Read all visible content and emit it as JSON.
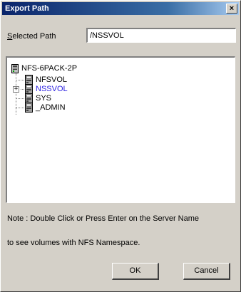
{
  "dialog": {
    "title": "Export Path",
    "close_glyph": "×"
  },
  "path": {
    "label": "Selected Path",
    "label_accel": "S",
    "label_rest": "elected Path",
    "value": "/NSSVOL"
  },
  "tree": {
    "root": {
      "label": "NFS-6PACK-2P",
      "icon": "server-icon"
    },
    "children": [
      {
        "label": "NFSVOL",
        "icon": "volume-icon",
        "expandable": false,
        "selected": false
      },
      {
        "label": "NSSVOL",
        "icon": "volume-icon",
        "expandable": true,
        "selected": true
      },
      {
        "label": "SYS",
        "icon": "volume-icon",
        "expandable": false,
        "selected": false
      },
      {
        "label": "_ADMIN",
        "icon": "volume-icon",
        "expandable": false,
        "selected": false
      }
    ]
  },
  "note": {
    "line1": "Note : Double Click or Press Enter on the Server Name",
    "line2": "to see volumes with NFS Namespace."
  },
  "buttons": {
    "ok": "OK",
    "cancel": "Cancel"
  },
  "colors": {
    "title_bar": "#0a246a",
    "selected_text": "#2a1fe0",
    "dialog_bg": "#d4d0c8"
  }
}
